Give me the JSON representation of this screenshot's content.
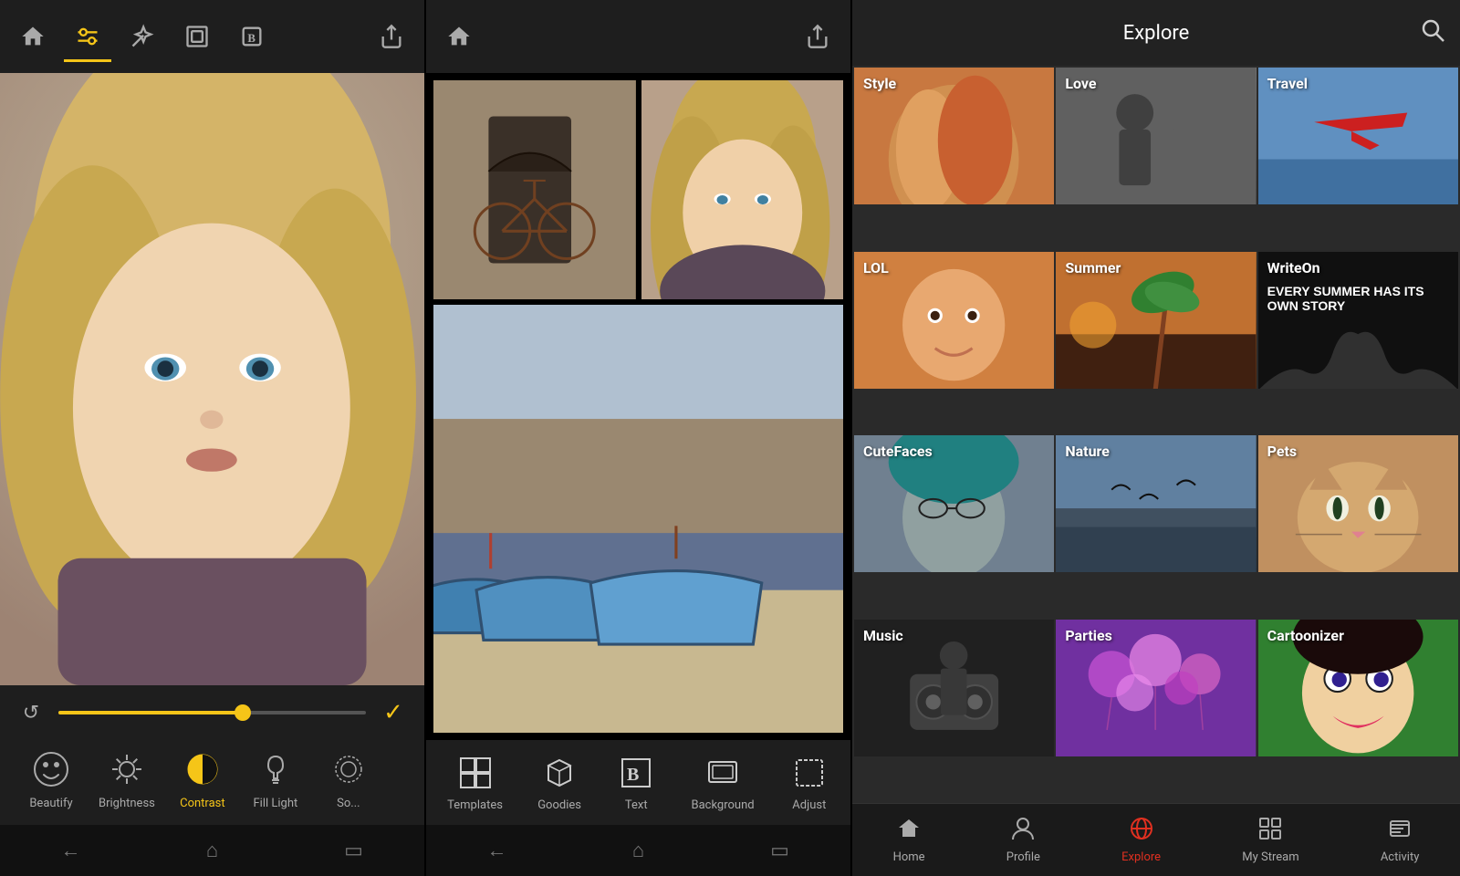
{
  "panel1": {
    "toolbar": {
      "home_label": "🏠",
      "adjust_label": "⚙",
      "wand_label": "✦",
      "frame_label": "▭",
      "bold_label": "B",
      "share_label": "⇧"
    },
    "controls": {
      "undo_label": "↺",
      "check_label": "✓"
    },
    "tools": [
      {
        "id": "beautify",
        "label": "Beautify",
        "icon": "beautify"
      },
      {
        "id": "brightness",
        "label": "Brightness",
        "icon": "sun"
      },
      {
        "id": "contrast",
        "label": "Contrast",
        "icon": "contrast"
      },
      {
        "id": "fill-light",
        "label": "Fill Light",
        "icon": "light"
      },
      {
        "id": "soften",
        "label": "So...",
        "icon": "soften"
      }
    ],
    "active_tool": "contrast",
    "bottom_nav": [
      "←",
      "⌂",
      "▭"
    ]
  },
  "panel2": {
    "toolbar_home": "🏠",
    "toolbar_share": "⇧",
    "tools": [
      {
        "id": "templates",
        "label": "Templates",
        "icon": "grid"
      },
      {
        "id": "goodies",
        "label": "Goodies",
        "icon": "cube"
      },
      {
        "id": "text",
        "label": "Text",
        "icon": "B"
      },
      {
        "id": "background",
        "label": "Background",
        "icon": "layers"
      },
      {
        "id": "adjust",
        "label": "Adjust",
        "icon": "dashed"
      }
    ],
    "bottom_nav": [
      "←",
      "⌂",
      "▭"
    ]
  },
  "panel3": {
    "title": "Explore",
    "search_icon": "🔍",
    "grid_items": [
      {
        "id": "style",
        "label": "Style",
        "bg": "style"
      },
      {
        "id": "love",
        "label": "Love",
        "bg": "love"
      },
      {
        "id": "travel",
        "label": "Travel",
        "bg": "travel"
      },
      {
        "id": "lol",
        "label": "LOL",
        "bg": "lol"
      },
      {
        "id": "summer",
        "label": "Summer",
        "bg": "summer"
      },
      {
        "id": "writeon",
        "label": "WriteOn",
        "bg": "writeon",
        "extra": "EVERY SUMMER HAS ITS OWN STORY"
      },
      {
        "id": "cutefaces",
        "label": "CuteFaces",
        "bg": "cutefaces"
      },
      {
        "id": "nature",
        "label": "Nature",
        "bg": "nature"
      },
      {
        "id": "pets",
        "label": "Pets",
        "bg": "pets"
      },
      {
        "id": "music",
        "label": "Music",
        "bg": "music"
      },
      {
        "id": "parties",
        "label": "Parties",
        "bg": "parties"
      },
      {
        "id": "cartoonizer",
        "label": "Cartoonizer",
        "bg": "cartoonizer"
      }
    ],
    "bottom_nav": [
      {
        "id": "home",
        "label": "Home",
        "icon": "🏠",
        "active": false
      },
      {
        "id": "profile",
        "label": "Profile",
        "icon": "👤",
        "active": false
      },
      {
        "id": "explore",
        "label": "Explore",
        "icon": "🌐",
        "active": true
      },
      {
        "id": "mystream",
        "label": "My Stream",
        "icon": "⊞",
        "active": false
      },
      {
        "id": "activity",
        "label": "Activity",
        "icon": "☰",
        "active": false
      }
    ]
  }
}
